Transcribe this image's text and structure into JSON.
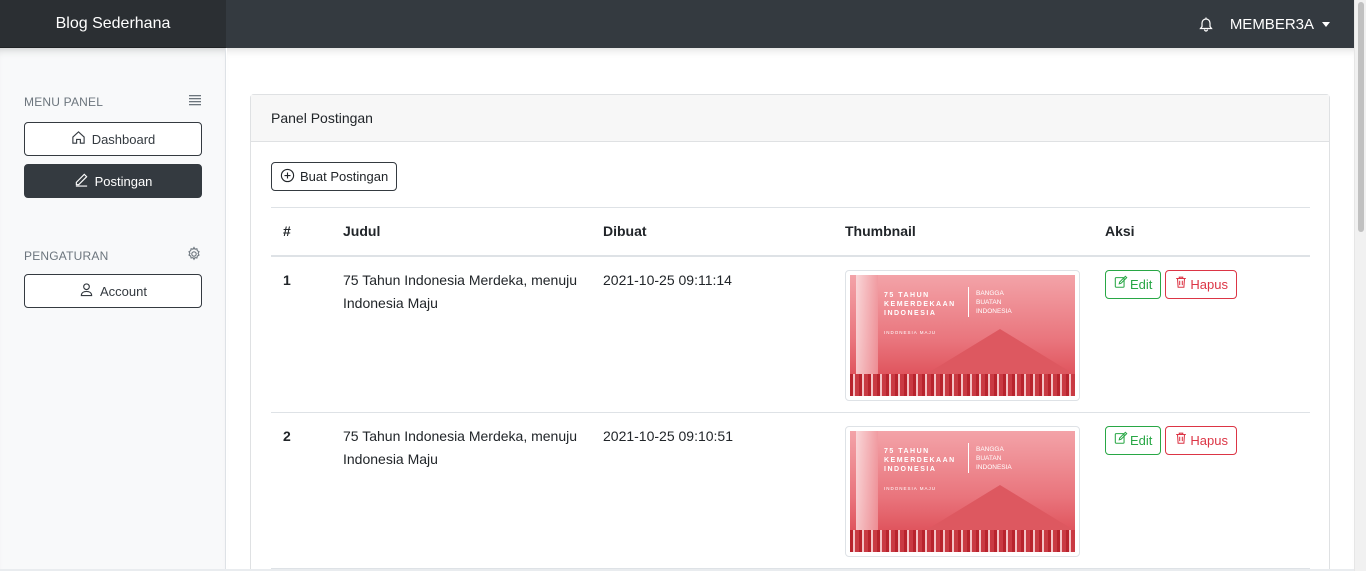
{
  "header": {
    "brand": "Blog Sederhana",
    "user": "MEMBER3A"
  },
  "sidebar": {
    "menu_heading": "MENU PANEL",
    "settings_heading": "PENGATURAN",
    "items": [
      {
        "label": "Dashboard",
        "icon": "home-icon"
      },
      {
        "label": "Postingan",
        "icon": "pencil-icon",
        "active": true
      },
      {
        "label": "Account",
        "icon": "person-icon"
      }
    ]
  },
  "panel": {
    "title": "Panel Postingan",
    "create_label": "Buat Postingan"
  },
  "table": {
    "headers": [
      "#",
      "Judul",
      "Dibuat",
      "Thumbnail",
      "Aksi"
    ],
    "rows": [
      {
        "num": "1",
        "title": "75 Tahun Indonesia Merdeka, menuju Indonesia Maju",
        "created": "2021-10-25 09:11:14"
      },
      {
        "num": "2",
        "title": "75 Tahun Indonesia Merdeka, menuju Indonesia Maju",
        "created": "2021-10-25 09:10:51"
      }
    ],
    "edit_label": "Edit",
    "delete_label": "Hapus"
  },
  "thumbnail": {
    "line1": "75 TAHUN",
    "line2": "KEMERDEKAAN",
    "line3": "INDONESIA",
    "right1": "BANGGA",
    "right2": "BUATAN",
    "right3": "INDONESIA",
    "small": "INDONESIA MAJU"
  }
}
